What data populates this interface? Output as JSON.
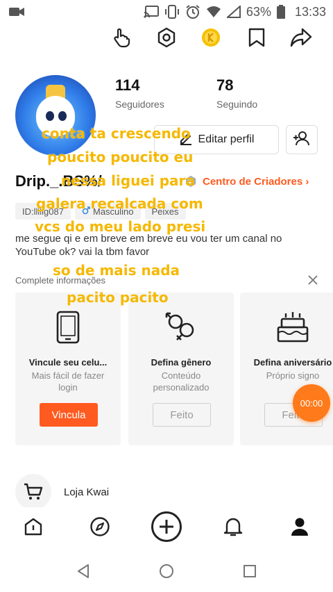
{
  "status_bar": {
    "battery_percent": "63%",
    "time": "13:33",
    "icons": [
      "video-camera-icon",
      "cast-icon",
      "vibrate-icon",
      "alarm-icon",
      "wifi-icon",
      "signal-icon",
      "battery-icon"
    ]
  },
  "top_bar": {
    "icons": [
      "hand-pointer-icon",
      "hexagon-settings-icon",
      "gold-coin-icon",
      "bookmark-icon",
      "share-icon"
    ]
  },
  "profile": {
    "followers_count": "114",
    "followers_label": "Seguidores",
    "following_count": "78",
    "following_label": "Seguindo",
    "edit_profile_label": "Editar perfil",
    "username": "Drip._.BS%/",
    "creators_center_label": "Centro de Criadores ›",
    "tags": {
      "id": "ID:lllllg087",
      "gender": "Masculino",
      "sign": "Peixes"
    },
    "bio": "me segue qi e em breve em breve eu vou ter um canal no YouTube ok? vai la tbm favor"
  },
  "complete_info": {
    "title": "Complete informações",
    "cards": [
      {
        "title": "Vincule seu celu...",
        "subtitle": "Mais fácil de fazer  login",
        "button": "Vincula",
        "button_style": "primary"
      },
      {
        "title": "Defina gênero",
        "subtitle": "Conteúdo personalizado",
        "button": "Feito",
        "button_style": "ghost"
      },
      {
        "title": "Defina aniversário",
        "subtitle": "Próprio signo",
        "button": "Feito",
        "button_style": "ghost"
      }
    ]
  },
  "timer_label": "00:00",
  "shop": {
    "label": "Loja Kwai"
  },
  "bottom_nav": {
    "icons": [
      "home-icon",
      "discover-icon",
      "create-plus-icon",
      "notifications-bell-icon",
      "profile-icon"
    ]
  },
  "system_nav": {
    "icons": [
      "back-icon",
      "home-circle-icon",
      "recents-icon"
    ]
  },
  "overlay_caption": {
    "lines": [
      "conta  ta crescendo",
      "poucito poucito eu",
      "nessa liguei para",
      "galera recalcada com",
      "vcs do meu lado presi",
      "so de mais nada",
      "pacito pacito"
    ]
  },
  "colors": {
    "accent": "#ff5a1f",
    "overlay_text": "#f5b800",
    "timer": "#ff7a1a"
  }
}
